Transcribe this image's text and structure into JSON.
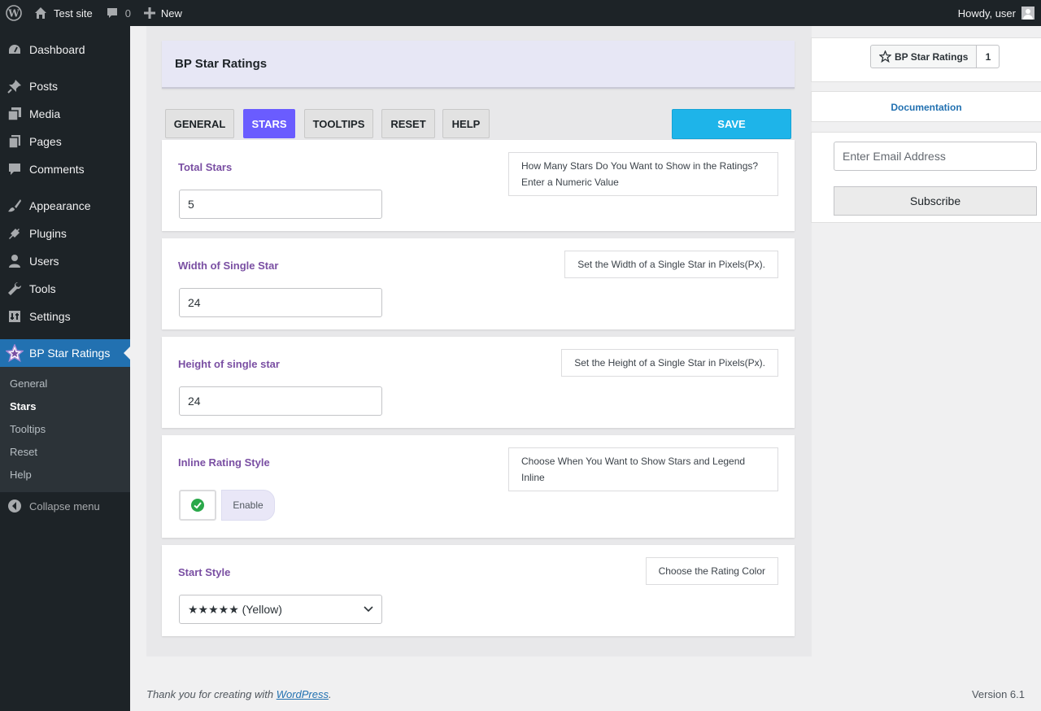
{
  "adminbar": {
    "site_name": "Test site",
    "comments_count": "0",
    "new_label": "New",
    "greeting": "Howdy, user"
  },
  "sidebar": {
    "items": [
      {
        "label": "Dashboard",
        "icon": "dashboard-icon"
      },
      {
        "label": "Posts",
        "icon": "pushpin-icon"
      },
      {
        "label": "Media",
        "icon": "media-icon"
      },
      {
        "label": "Pages",
        "icon": "pages-icon"
      },
      {
        "label": "Comments",
        "icon": "comment-icon"
      },
      {
        "label": "Appearance",
        "icon": "paintbrush-icon"
      },
      {
        "label": "Plugins",
        "icon": "plugin-icon"
      },
      {
        "label": "Users",
        "icon": "user-icon"
      },
      {
        "label": "Tools",
        "icon": "wrench-icon"
      },
      {
        "label": "Settings",
        "icon": "settings-icon"
      },
      {
        "label": "BP Star Ratings",
        "icon": "star-icon"
      }
    ],
    "submenu": [
      "General",
      "Stars",
      "Tooltips",
      "Reset",
      "Help"
    ],
    "submenu_current": "Stars",
    "collapse_label": "Collapse menu"
  },
  "page": {
    "title": "BP Star Ratings",
    "tabs": [
      "GENERAL",
      "STARS",
      "TOOLTIPS",
      "RESET",
      "HELP"
    ],
    "active_tab": "STARS",
    "save_label": "SAVE"
  },
  "settings": {
    "total_stars": {
      "label": "Total Stars",
      "value": "5",
      "help": [
        "How Many Stars Do You Want to Show in the Ratings?",
        "Enter a Numeric Value"
      ]
    },
    "star_width": {
      "label": "Width of Single Star",
      "value": "24",
      "help": "Set the Width of a Single Star in Pixels(Px)."
    },
    "star_height": {
      "label": "Height of single star",
      "value": "24",
      "help": "Set the Height of a Single Star in Pixels(Px)."
    },
    "inline_style": {
      "label": "Inline Rating Style",
      "toggle_label": "Enable",
      "enabled": true,
      "help": [
        "Choose When You Want to Show Stars and Legend",
        "Inline"
      ]
    },
    "start_style": {
      "label": "Start Style",
      "selected": "★★★★★ (Yellow)",
      "help": "Choose the Rating Color"
    }
  },
  "right_panel": {
    "rating_button_label": "BP Star Ratings",
    "rating_count": "1",
    "documentation_link": "Documentation",
    "email_placeholder": "Enter Email Address",
    "subscribe_label": "Subscribe"
  },
  "footer": {
    "thanks_prefix": "Thank you for creating with ",
    "thanks_link": "WordPress",
    "thanks_suffix": ".",
    "version": "Version 6.1"
  },
  "colors": {
    "accent_purple": "#6a5cff",
    "save_blue": "#1eb4e9",
    "label_purple": "#7a4fa3",
    "wp_blue": "#2271b1",
    "check_green": "#2aa84a"
  }
}
